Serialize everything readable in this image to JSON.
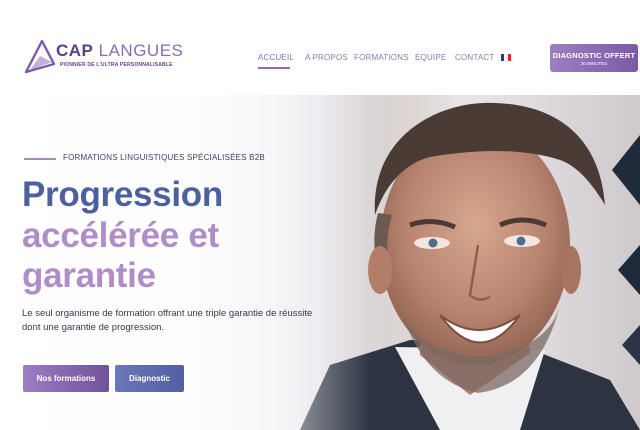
{
  "brand": {
    "logo_cap": "CAP",
    "logo_langues": "LANGUES",
    "tagline": "PIONNIER DE L'ULTRA PERSONNALISABLE"
  },
  "nav": {
    "items": [
      {
        "label": "ACCUEIL",
        "active": true
      },
      {
        "label": "A PROPOS",
        "active": false
      },
      {
        "label": "FORMATIONS",
        "active": false
      },
      {
        "label": "EQUIPE",
        "active": false
      },
      {
        "label": "CONTACT",
        "active": false
      }
    ],
    "language_icon": "french-flag-icon"
  },
  "cta": {
    "label": "DIAGNOSTIC OFFERT",
    "sublabel": "30 MINUTES"
  },
  "hero": {
    "eyebrow": "FORMATIONS LINGUISTIQUES SPÉCIALISÉES B2B",
    "title_line1": "Progression",
    "title_line2": "accélérée et",
    "title_line3": "garantie",
    "lead": "Le seul organisme de formation offrant une triple garantie de réussite dont une garantie de progression.",
    "button_primary": "Nos formations",
    "button_secondary": "Diagnostic",
    "image_icon": "smiling-businessman-photo"
  },
  "colors": {
    "brand_purple": "#8f6cb5",
    "title_blue": "#4e5fa1",
    "title_violet": "#b08dc7"
  }
}
